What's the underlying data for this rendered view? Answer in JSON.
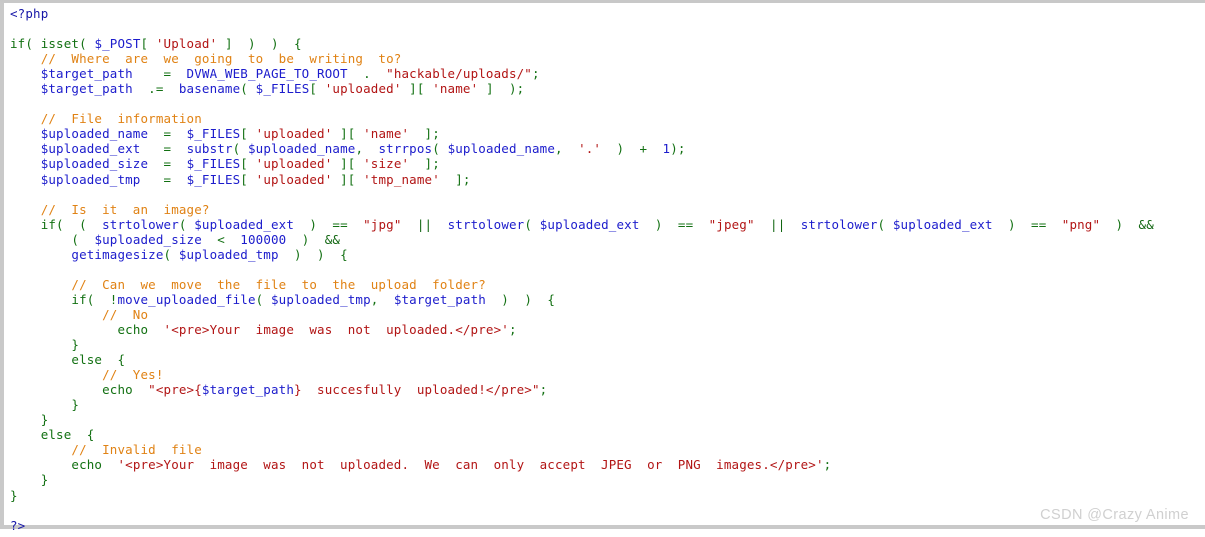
{
  "panel": {
    "language": "php",
    "background_color": "#ffffff",
    "border_color": "#c9c9c9"
  },
  "palette": {
    "tag": "#1818a8",
    "keyword": "#127012",
    "variable": "#1c1ccc",
    "string": "#b21515",
    "comment": "#e08214",
    "logical": "#116611",
    "watermark": "#d0d0d0"
  },
  "watermark": {
    "text": "CSDN @Crazy Anime"
  },
  "code": {
    "lines": [
      {
        "n": 1,
        "indent": 0,
        "tokens": [
          {
            "t": "tag",
            "v": "<?php"
          }
        ]
      },
      {
        "n": 2,
        "indent": 0,
        "tokens": []
      },
      {
        "n": 3,
        "indent": 0,
        "tokens": [
          {
            "t": "kw",
            "v": "if( "
          },
          {
            "t": "kw",
            "v": "isset( "
          },
          {
            "t": "var",
            "v": "$_POST"
          },
          {
            "t": "kw",
            "v": "[ "
          },
          {
            "t": "str",
            "v": "'Upload'"
          },
          {
            "t": "kw",
            "v": " ]  )  )  {"
          }
        ]
      },
      {
        "n": 4,
        "indent": 4,
        "tokens": [
          {
            "t": "cmt",
            "v": "//  Where  are  we  going  to  be  writing  to?"
          }
        ]
      },
      {
        "n": 5,
        "indent": 4,
        "tokens": [
          {
            "t": "var",
            "v": "$target_path"
          },
          {
            "t": "kw",
            "v": "    =  "
          },
          {
            "t": "var",
            "v": "DVWA_WEB_PAGE_TO_ROOT"
          },
          {
            "t": "kw",
            "v": "  .  "
          },
          {
            "t": "str",
            "v": "\"hackable/uploads/\""
          },
          {
            "t": "semi",
            "v": ";"
          }
        ]
      },
      {
        "n": 6,
        "indent": 4,
        "tokens": [
          {
            "t": "var",
            "v": "$target_path"
          },
          {
            "t": "kw",
            "v": "  .=  "
          },
          {
            "t": "var",
            "v": "basename"
          },
          {
            "t": "kw",
            "v": "( "
          },
          {
            "t": "var",
            "v": "$_FILES"
          },
          {
            "t": "kw",
            "v": "[ "
          },
          {
            "t": "str",
            "v": "'uploaded'"
          },
          {
            "t": "kw",
            "v": " ][ "
          },
          {
            "t": "str",
            "v": "'name'"
          },
          {
            "t": "kw",
            "v": " ]  );"
          }
        ]
      },
      {
        "n": 7,
        "indent": 0,
        "tokens": []
      },
      {
        "n": 8,
        "indent": 4,
        "tokens": [
          {
            "t": "cmt",
            "v": "//  File  information"
          }
        ]
      },
      {
        "n": 9,
        "indent": 4,
        "tokens": [
          {
            "t": "var",
            "v": "$uploaded_name"
          },
          {
            "t": "kw",
            "v": "  =  "
          },
          {
            "t": "var",
            "v": "$_FILES"
          },
          {
            "t": "kw",
            "v": "[ "
          },
          {
            "t": "str",
            "v": "'uploaded'"
          },
          {
            "t": "kw",
            "v": " ][ "
          },
          {
            "t": "str",
            "v": "'name'"
          },
          {
            "t": "kw",
            "v": "  ];"
          }
        ]
      },
      {
        "n": 10,
        "indent": 4,
        "tokens": [
          {
            "t": "var",
            "v": "$uploaded_ext"
          },
          {
            "t": "kw",
            "v": "   =  "
          },
          {
            "t": "var",
            "v": "substr"
          },
          {
            "t": "kw",
            "v": "( "
          },
          {
            "t": "var",
            "v": "$uploaded_name"
          },
          {
            "t": "kw",
            "v": ",  "
          },
          {
            "t": "var",
            "v": "strrpos"
          },
          {
            "t": "kw",
            "v": "( "
          },
          {
            "t": "var",
            "v": "$uploaded_name"
          },
          {
            "t": "kw",
            "v": ",  "
          },
          {
            "t": "str",
            "v": "'.'"
          },
          {
            "t": "kw",
            "v": "  )  +  "
          },
          {
            "t": "var",
            "v": "1"
          },
          {
            "t": "kw",
            "v": ");"
          }
        ]
      },
      {
        "n": 11,
        "indent": 4,
        "tokens": [
          {
            "t": "var",
            "v": "$uploaded_size"
          },
          {
            "t": "kw",
            "v": "  =  "
          },
          {
            "t": "var",
            "v": "$_FILES"
          },
          {
            "t": "kw",
            "v": "[ "
          },
          {
            "t": "str",
            "v": "'uploaded'"
          },
          {
            "t": "kw",
            "v": " ][ "
          },
          {
            "t": "str",
            "v": "'size'"
          },
          {
            "t": "kw",
            "v": "  ];"
          }
        ]
      },
      {
        "n": 12,
        "indent": 4,
        "tokens": [
          {
            "t": "var",
            "v": "$uploaded_tmp"
          },
          {
            "t": "kw",
            "v": "   =  "
          },
          {
            "t": "var",
            "v": "$_FILES"
          },
          {
            "t": "kw",
            "v": "[ "
          },
          {
            "t": "str",
            "v": "'uploaded'"
          },
          {
            "t": "kw",
            "v": " ][ "
          },
          {
            "t": "str",
            "v": "'tmp_name'"
          },
          {
            "t": "kw",
            "v": "  ];"
          }
        ]
      },
      {
        "n": 13,
        "indent": 0,
        "tokens": []
      },
      {
        "n": 14,
        "indent": 4,
        "tokens": [
          {
            "t": "cmt",
            "v": "//  Is  it  an  image?"
          }
        ]
      },
      {
        "n": 15,
        "indent": 4,
        "tokens": [
          {
            "t": "kw",
            "v": "if(  (  "
          },
          {
            "t": "var",
            "v": "strtolower"
          },
          {
            "t": "kw",
            "v": "( "
          },
          {
            "t": "var",
            "v": "$uploaded_ext"
          },
          {
            "t": "kw",
            "v": "  )  ==  "
          },
          {
            "t": "str",
            "v": "\"jpg\""
          },
          {
            "t": "kw",
            "v": "  "
          },
          {
            "t": "logic",
            "v": "||"
          },
          {
            "t": "kw",
            "v": "  "
          },
          {
            "t": "var",
            "v": "strtolower"
          },
          {
            "t": "kw",
            "v": "( "
          },
          {
            "t": "var",
            "v": "$uploaded_ext"
          },
          {
            "t": "kw",
            "v": "  )  ==  "
          },
          {
            "t": "str",
            "v": "\"jpeg\""
          },
          {
            "t": "kw",
            "v": "  "
          },
          {
            "t": "logic",
            "v": "||"
          },
          {
            "t": "kw",
            "v": "  "
          },
          {
            "t": "var",
            "v": "strtolower"
          },
          {
            "t": "kw",
            "v": "( "
          },
          {
            "t": "var",
            "v": "$uploaded_ext"
          },
          {
            "t": "kw",
            "v": "  )  ==  "
          },
          {
            "t": "str",
            "v": "\"png\""
          },
          {
            "t": "kw",
            "v": "  )  "
          },
          {
            "t": "logic",
            "v": "&&"
          }
        ]
      },
      {
        "n": 16,
        "indent": 8,
        "tokens": [
          {
            "t": "kw",
            "v": "(  "
          },
          {
            "t": "var",
            "v": "$uploaded_size"
          },
          {
            "t": "kw",
            "v": "  <  "
          },
          {
            "t": "var",
            "v": "100000"
          },
          {
            "t": "kw",
            "v": "  )  "
          },
          {
            "t": "logic",
            "v": "&&"
          }
        ]
      },
      {
        "n": 17,
        "indent": 8,
        "tokens": [
          {
            "t": "var",
            "v": "getimagesize"
          },
          {
            "t": "kw",
            "v": "( "
          },
          {
            "t": "var",
            "v": "$uploaded_tmp"
          },
          {
            "t": "kw",
            "v": "  )  )  {"
          }
        ]
      },
      {
        "n": 18,
        "indent": 0,
        "tokens": []
      },
      {
        "n": 19,
        "indent": 8,
        "tokens": [
          {
            "t": "cmt",
            "v": "//  Can  we  move  the  file  to  the  upload  folder?"
          }
        ]
      },
      {
        "n": 20,
        "indent": 8,
        "tokens": [
          {
            "t": "kw",
            "v": "if(  !"
          },
          {
            "t": "var",
            "v": "move_uploaded_file"
          },
          {
            "t": "kw",
            "v": "( "
          },
          {
            "t": "var",
            "v": "$uploaded_tmp"
          },
          {
            "t": "kw",
            "v": ",  "
          },
          {
            "t": "var",
            "v": "$target_path"
          },
          {
            "t": "kw",
            "v": "  )  )  {"
          }
        ]
      },
      {
        "n": 21,
        "indent": 12,
        "tokens": [
          {
            "t": "cmt",
            "v": "//  No"
          }
        ]
      },
      {
        "n": 22,
        "indent": 14,
        "tokens": [
          {
            "t": "kw",
            "v": "echo  "
          },
          {
            "t": "str",
            "v": "'<pre>Your  image  was  not  uploaded.</pre>'"
          },
          {
            "t": "semi",
            "v": ";"
          }
        ]
      },
      {
        "n": 23,
        "indent": 8,
        "tokens": [
          {
            "t": "kw",
            "v": "}"
          }
        ]
      },
      {
        "n": 24,
        "indent": 8,
        "tokens": [
          {
            "t": "kw",
            "v": "else  {"
          }
        ]
      },
      {
        "n": 25,
        "indent": 12,
        "tokens": [
          {
            "t": "cmt",
            "v": "//  Yes!"
          }
        ]
      },
      {
        "n": 26,
        "indent": 12,
        "tokens": [
          {
            "t": "kw",
            "v": "echo  "
          },
          {
            "t": "str",
            "v": "\"<pre>{"
          },
          {
            "t": "var",
            "v": "$target_path"
          },
          {
            "t": "str",
            "v": "}  succesfully  uploaded!</pre>\""
          },
          {
            "t": "semi",
            "v": ";"
          }
        ]
      },
      {
        "n": 27,
        "indent": 8,
        "tokens": [
          {
            "t": "kw",
            "v": "}"
          }
        ]
      },
      {
        "n": 28,
        "indent": 4,
        "tokens": [
          {
            "t": "kw",
            "v": "}"
          }
        ]
      },
      {
        "n": 29,
        "indent": 4,
        "tokens": [
          {
            "t": "kw",
            "v": "else  {"
          }
        ]
      },
      {
        "n": 30,
        "indent": 8,
        "tokens": [
          {
            "t": "cmt",
            "v": "//  Invalid  file"
          }
        ]
      },
      {
        "n": 31,
        "indent": 8,
        "tokens": [
          {
            "t": "kw",
            "v": "echo  "
          },
          {
            "t": "str",
            "v": "'<pre>Your  image  was  not  uploaded.  We  can  only  accept  JPEG  or  PNG  images.</pre>'"
          },
          {
            "t": "semi",
            "v": ";"
          }
        ]
      },
      {
        "n": 32,
        "indent": 4,
        "tokens": [
          {
            "t": "kw",
            "v": "}"
          }
        ]
      },
      {
        "n": 33,
        "indent": 0,
        "tokens": [
          {
            "t": "kw",
            "v": "}"
          }
        ]
      },
      {
        "n": 34,
        "indent": 0,
        "tokens": []
      },
      {
        "n": 35,
        "indent": 0,
        "tokens": [
          {
            "t": "tag",
            "v": "?>"
          }
        ]
      }
    ]
  }
}
